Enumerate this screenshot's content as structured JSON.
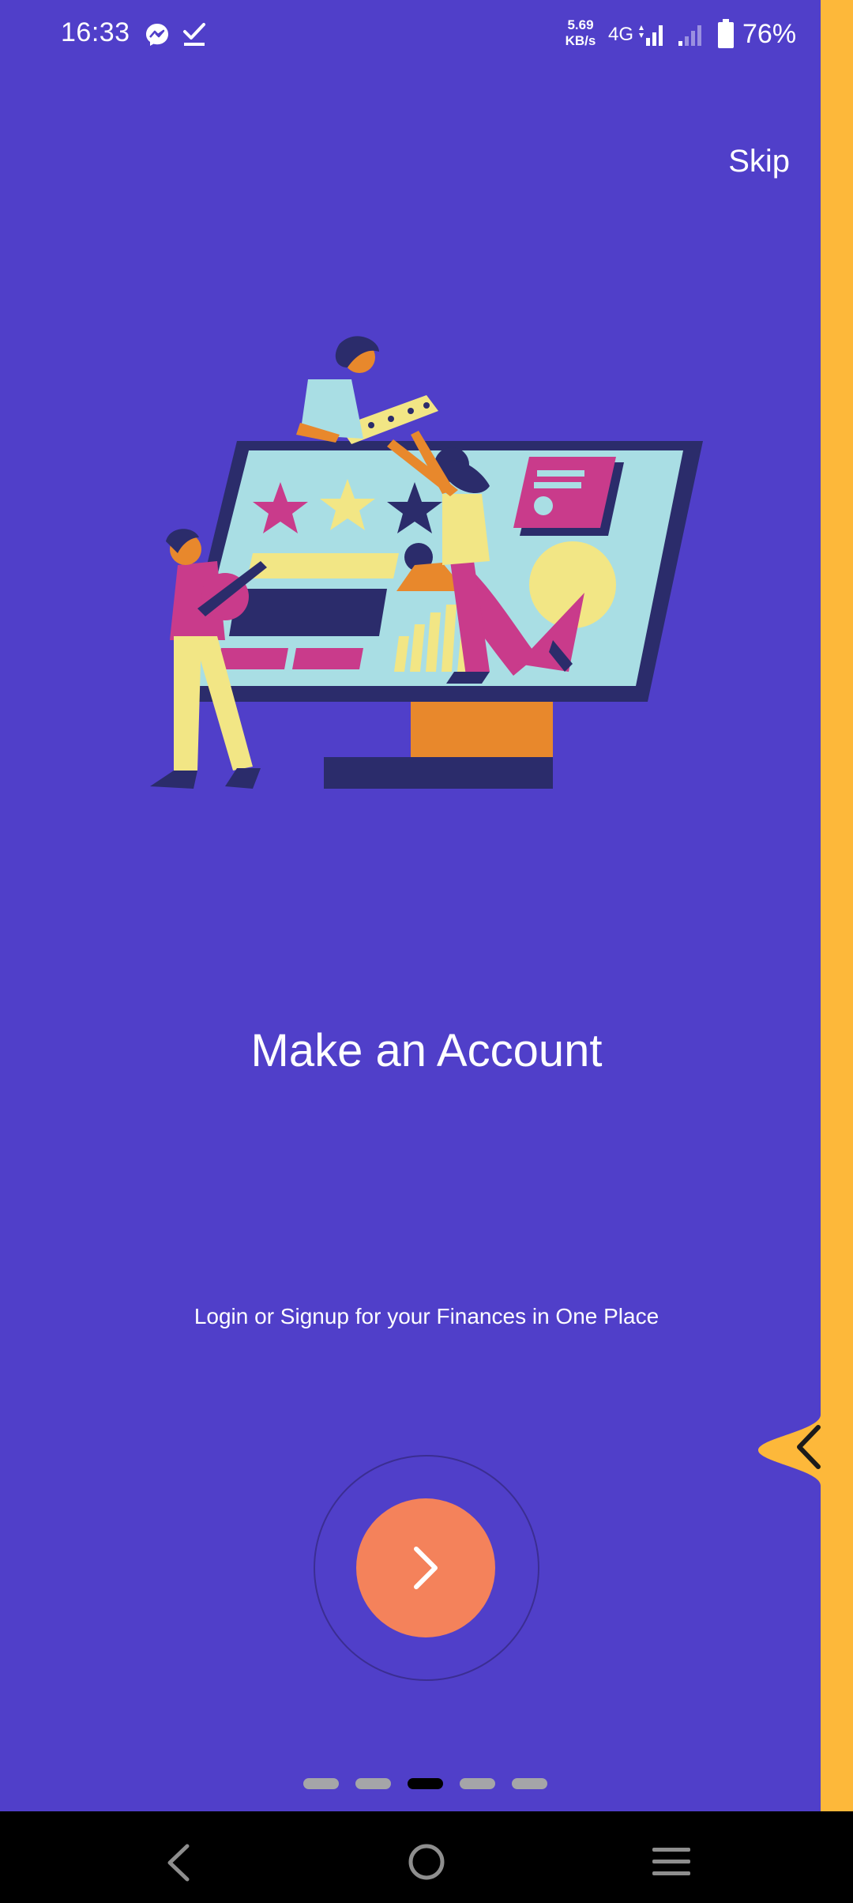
{
  "status_bar": {
    "time": "16:33",
    "net_speed_value": "5.69",
    "net_speed_unit": "KB/s",
    "network_type": "4G",
    "battery": "76%",
    "icons": [
      "messenger-icon",
      "task-done-icon",
      "signal-icon",
      "signal-icon",
      "battery-icon"
    ]
  },
  "onboarding": {
    "skip_label": "Skip",
    "title": "Make an Account",
    "subtitle": "Login or Signup for your Finances in One Place",
    "page_count": 5,
    "current_page": 3
  },
  "colors": {
    "background": "#503FC9",
    "accent_edge": "#FDB83A",
    "next_button": "#F4825B",
    "dot_inactive": "#A5A5A8",
    "dot_active": "#000000"
  },
  "nav_bar": {
    "icons": [
      "back-icon",
      "home-icon",
      "menu-icon"
    ]
  }
}
